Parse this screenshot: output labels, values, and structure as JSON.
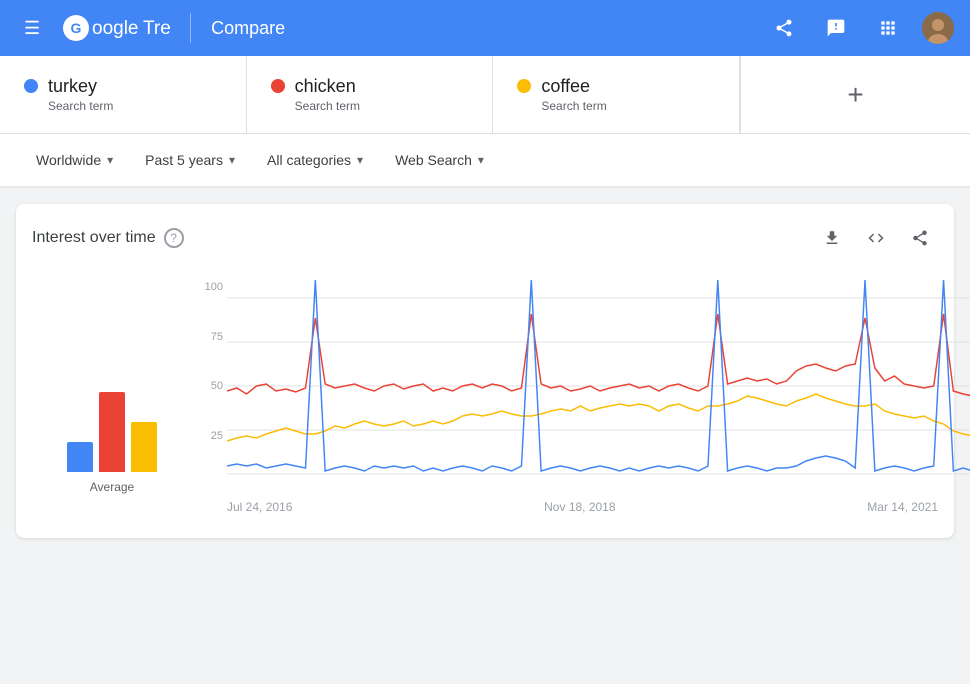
{
  "header": {
    "logo_g": "G",
    "logo_google": "oogle",
    "logo_trends": "Trends",
    "compare_label": "Compare",
    "share_icon": "share",
    "feedback_icon": "feedback",
    "apps_icon": "apps"
  },
  "search_terms": [
    {
      "id": "turkey",
      "name": "turkey",
      "type": "Search term",
      "color": "#4285f4"
    },
    {
      "id": "chicken",
      "name": "chicken",
      "type": "Search term",
      "color": "#ea4335"
    },
    {
      "id": "coffee",
      "name": "coffee",
      "type": "Search term",
      "color": "#fbbc04"
    }
  ],
  "add_term_label": "+",
  "filters": [
    {
      "id": "location",
      "label": "Worldwide"
    },
    {
      "id": "time",
      "label": "Past 5 years"
    },
    {
      "id": "category",
      "label": "All categories"
    },
    {
      "id": "search_type",
      "label": "Web Search"
    }
  ],
  "interest_over_time": {
    "title": "Interest over time",
    "help_label": "?",
    "download_icon": "↓",
    "embed_icon": "<>",
    "share_icon": "share"
  },
  "chart": {
    "y_labels": [
      "100",
      "75",
      "50",
      "25"
    ],
    "x_labels": [
      "Jul 24, 2016",
      "Nov 18, 2018",
      "Mar 14, 2021"
    ],
    "bars": [
      {
        "color": "#4285f4",
        "height": 30,
        "value": 12
      },
      {
        "color": "#ea4335",
        "height": 80,
        "value": 50
      },
      {
        "color": "#fbbc04",
        "height": 50,
        "value": 30
      }
    ],
    "average_label": "Average"
  }
}
